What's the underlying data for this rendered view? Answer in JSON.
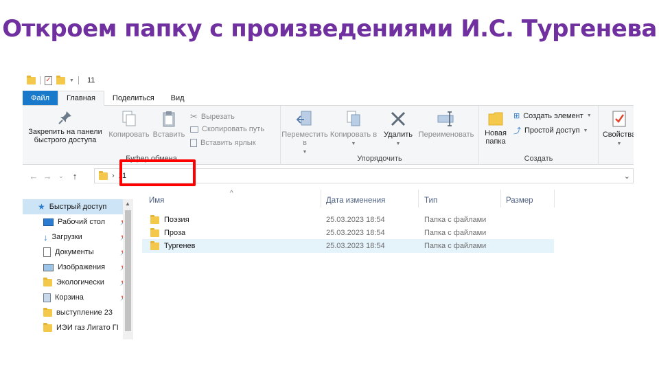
{
  "slide_title": "Откроем папку с произведениями И.С. Тургенева",
  "qat": {
    "path_title": "11"
  },
  "tabs": [
    {
      "label": "Файл"
    },
    {
      "label": "Главная"
    },
    {
      "label": "Поделиться"
    },
    {
      "label": "Вид"
    }
  ],
  "ribbon": {
    "clipboard": {
      "label": "Буфер обмена",
      "pin_label": "Закрепить на панели быстрого доступа",
      "copy_label": "Копировать",
      "paste_label": "Вставить",
      "cut_label": "Вырезать",
      "copy_path_label": "Скопировать путь",
      "paste_shortcut_label": "Вставить ярлык"
    },
    "organize": {
      "label": "Упорядочить",
      "move_label": "Переместить в",
      "copyto_label": "Копировать в",
      "delete_label": "Удалить",
      "rename_label": "Переименовать"
    },
    "create": {
      "label": "Создать",
      "new_folder_label": "Новая папка",
      "new_item_label": "Создать элемент",
      "easy_access_label": "Простой доступ"
    },
    "open": {
      "properties_label": "Свойства"
    }
  },
  "address": {
    "crumb": "11"
  },
  "sidebar": {
    "quick_access": "Быстрый доступ",
    "items": [
      {
        "label": "Рабочий стол",
        "icon": "desktop-icon",
        "pinned": true
      },
      {
        "label": "Загрузки",
        "icon": "download-icon",
        "pinned": true
      },
      {
        "label": "Документы",
        "icon": "documents-icon",
        "pinned": true
      },
      {
        "label": "Изображения",
        "icon": "pictures-icon",
        "pinned": true
      },
      {
        "label": "Экологически",
        "icon": "folder-icon",
        "pinned": true
      },
      {
        "label": "Корзина",
        "icon": "recycle-bin-icon",
        "pinned": true
      },
      {
        "label": "выступление 23",
        "icon": "folder-icon",
        "pinned": false
      },
      {
        "label": "ИЭИ газ Лигато ГІ",
        "icon": "folder-icon",
        "pinned": false
      }
    ]
  },
  "columns": {
    "name": "Имя",
    "date": "Дата изменения",
    "type": "Тип",
    "size": "Размер"
  },
  "files": [
    {
      "name": "Поэзия",
      "date": "25.03.2023 18:54",
      "type": "Папка с файлами"
    },
    {
      "name": "Проза",
      "date": "25.03.2023 18:54",
      "type": "Папка с файлами"
    },
    {
      "name": "Тургенев",
      "date": "25.03.2023 18:54",
      "type": "Папка с файлами",
      "selected": true
    }
  ],
  "colors": {
    "title": "#7030a0",
    "file_tab": "#1979ca",
    "highlight_box": "#ff0000",
    "selection": "#e5f3fb"
  }
}
